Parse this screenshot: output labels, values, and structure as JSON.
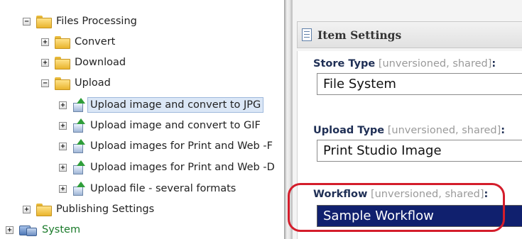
{
  "tree": {
    "nodes": [
      {
        "label": "Files Processing",
        "toggle": "−",
        "icon": "folder-icon"
      },
      {
        "label": "Convert",
        "toggle": "+",
        "icon": "folder-icon"
      },
      {
        "label": "Download",
        "toggle": "+",
        "icon": "folder-icon"
      },
      {
        "label": "Upload",
        "toggle": "−",
        "icon": "folder-icon"
      },
      {
        "label": "Upload image and convert to JPG",
        "toggle": "+",
        "icon": "upload-action-icon",
        "selected": true
      },
      {
        "label": "Upload image and convert to GIF",
        "toggle": "+",
        "icon": "upload-action-icon"
      },
      {
        "label": "Upload images for Print and Web -F",
        "toggle": "+",
        "icon": "upload-action-icon"
      },
      {
        "label": "Upload images for Print and Web -D",
        "toggle": "+",
        "icon": "upload-action-icon"
      },
      {
        "label": "Upload file - several formats",
        "toggle": "+",
        "icon": "upload-action-icon"
      },
      {
        "label": "Publishing Settings",
        "toggle": "+",
        "icon": "folder-icon"
      },
      {
        "label": "System",
        "toggle": "+",
        "icon": "system-icon"
      }
    ]
  },
  "settings": {
    "title": "Item Settings",
    "fields": [
      {
        "name": "Store Type",
        "meta": "[unversioned, shared]",
        "colon": ":",
        "value": "File System"
      },
      {
        "name": "Upload Type",
        "meta": "[unversioned, shared]",
        "colon": ":",
        "value": "Print Studio Image"
      },
      {
        "name": "Workflow",
        "meta": "[unversioned, shared]",
        "colon": ":",
        "value": "Sample Workflow"
      }
    ]
  },
  "colors": {
    "selection_bg": "#10206e",
    "highlight_circle": "#d41d2b",
    "label_blue": "#1f2f55",
    "system_green": "#1a7a2a"
  }
}
